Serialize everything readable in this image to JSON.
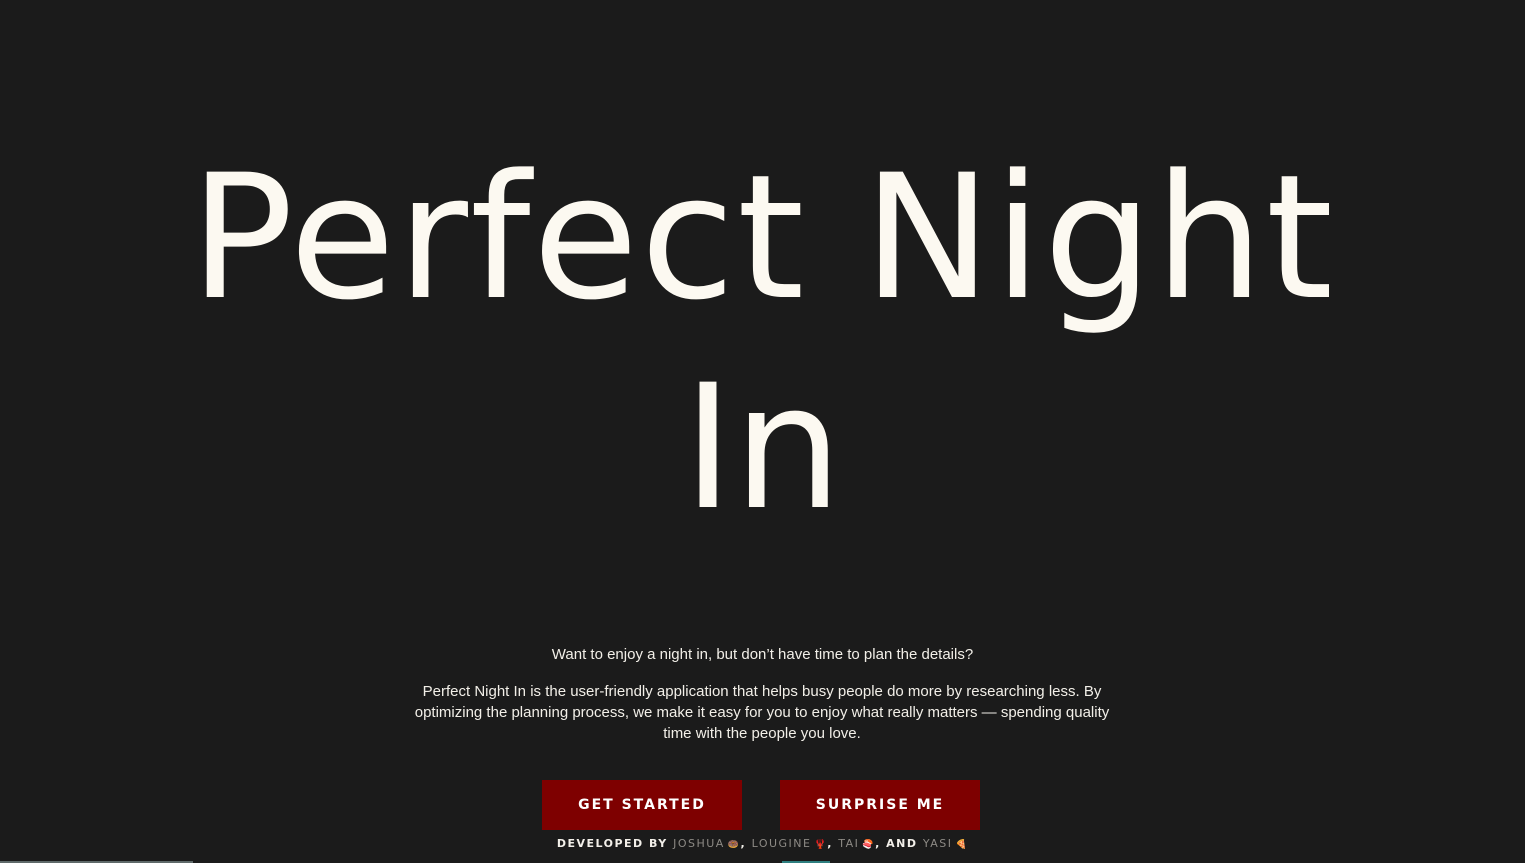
{
  "hero": {
    "title_line_1": "Perfect Night",
    "title_line_2": "In"
  },
  "intro": {
    "tagline": "Want to enjoy a night in, but don’t have time to plan the details?",
    "description": "Perfect Night In is the user-friendly application that helps busy people do more by researching less. By optimizing the planning process, we make it easy for you to enjoy what really matters — spending quality time with the people you love."
  },
  "actions": {
    "get_started_label": "GET STARTED",
    "surprise_me_label": "SURPRISE ME"
  },
  "credits": {
    "prefix": "DEVELOPED BY",
    "developers": [
      {
        "name": "JOSHUA",
        "emoji": "🍩"
      },
      {
        "name": "LOUGINE",
        "emoji": "🦞"
      },
      {
        "name": "TAI",
        "emoji": "🍣"
      },
      {
        "name": "YASI",
        "emoji": "🍕"
      }
    ],
    "separator": ",",
    "conjunction": "AND"
  },
  "colors": {
    "background": "#1b1b1b",
    "text": "#fcf9f1",
    "button": "#7e0000",
    "developer_name": "#8d8a85"
  }
}
